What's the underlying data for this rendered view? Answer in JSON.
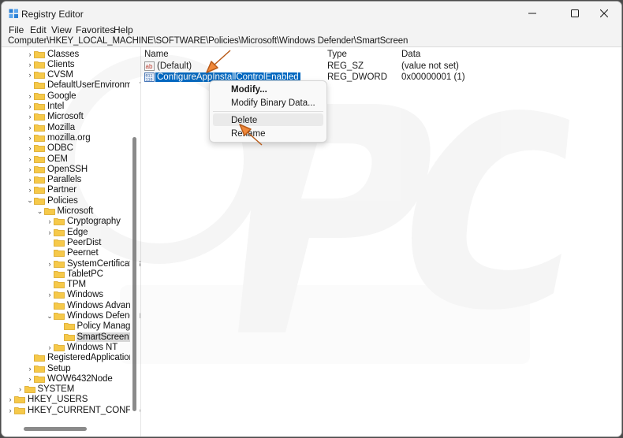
{
  "window": {
    "title": "Registry Editor",
    "controls": {
      "minimize": "—",
      "maximize": "☐",
      "close": "✕"
    }
  },
  "menu": [
    "File",
    "Edit",
    "View",
    "Favorites",
    "Help"
  ],
  "address": "Computer\\HKEY_LOCAL_MACHINE\\SOFTWARE\\Policies\\Microsoft\\Windows Defender\\SmartScreen",
  "tree": [
    {
      "label": "Classes",
      "chevron": "›",
      "depth": 2
    },
    {
      "label": "Clients",
      "chevron": "›",
      "depth": 2
    },
    {
      "label": "CVSM",
      "chevron": "›",
      "depth": 2
    },
    {
      "label": "DefaultUserEnvironment",
      "chevron": "",
      "depth": 2
    },
    {
      "label": "Google",
      "chevron": "›",
      "depth": 2
    },
    {
      "label": "Intel",
      "chevron": "›",
      "depth": 2
    },
    {
      "label": "Microsoft",
      "chevron": "›",
      "depth": 2
    },
    {
      "label": "Mozilla",
      "chevron": "›",
      "depth": 2
    },
    {
      "label": "mozilla.org",
      "chevron": "›",
      "depth": 2
    },
    {
      "label": "ODBC",
      "chevron": "›",
      "depth": 2
    },
    {
      "label": "OEM",
      "chevron": "›",
      "depth": 2
    },
    {
      "label": "OpenSSH",
      "chevron": "›",
      "depth": 2
    },
    {
      "label": "Parallels",
      "chevron": "›",
      "depth": 2
    },
    {
      "label": "Partner",
      "chevron": "›",
      "depth": 2
    },
    {
      "label": "Policies",
      "chevron": "⌄",
      "depth": 2
    },
    {
      "label": "Microsoft",
      "chevron": "⌄",
      "depth": 3
    },
    {
      "label": "Cryptography",
      "chevron": "›",
      "depth": 4
    },
    {
      "label": "Edge",
      "chevron": "›",
      "depth": 4
    },
    {
      "label": "PeerDist",
      "chevron": "",
      "depth": 4
    },
    {
      "label": "Peernet",
      "chevron": "",
      "depth": 4
    },
    {
      "label": "SystemCertificates",
      "chevron": "›",
      "depth": 4
    },
    {
      "label": "TabletPC",
      "chevron": "",
      "depth": 4
    },
    {
      "label": "TPM",
      "chevron": "",
      "depth": 4
    },
    {
      "label": "Windows",
      "chevron": "›",
      "depth": 4
    },
    {
      "label": "Windows Advanced",
      "chevron": "",
      "depth": 4
    },
    {
      "label": "Windows Defender",
      "chevron": "⌄",
      "depth": 4
    },
    {
      "label": "Policy Manager",
      "chevron": "",
      "depth": 5
    },
    {
      "label": "SmartScreen",
      "chevron": "",
      "depth": 5,
      "selected": true
    },
    {
      "label": "Windows NT",
      "chevron": "›",
      "depth": 4
    },
    {
      "label": "RegisteredApplications",
      "chevron": "",
      "depth": 2
    },
    {
      "label": "Setup",
      "chevron": "›",
      "depth": 2
    },
    {
      "label": "WOW6432Node",
      "chevron": "›",
      "depth": 2
    },
    {
      "label": "SYSTEM",
      "chevron": "›",
      "depth": 1
    },
    {
      "label": "HKEY_USERS",
      "chevron": "›",
      "depth": 0
    },
    {
      "label": "HKEY_CURRENT_CONFIG",
      "chevron": "›",
      "depth": 0
    }
  ],
  "columns": {
    "name": "Name",
    "type": "Type",
    "data": "Data"
  },
  "values": [
    {
      "name": "(Default)",
      "type": "REG_SZ",
      "data": "(value not set)",
      "icon": "string-value-icon"
    },
    {
      "name": "ConfigureAppInstallControlEnabled",
      "type": "REG_DWORD",
      "data": "0x00000001 (1)",
      "icon": "dword-value-icon",
      "selected": true
    }
  ],
  "context_menu": {
    "modify": "Modify...",
    "modify_binary": "Modify Binary Data...",
    "delete": "Delete",
    "rename": "Rename"
  },
  "colors": {
    "accent": "#0067c0",
    "folder": "#f6c94a",
    "arrow": "#f0883a"
  }
}
